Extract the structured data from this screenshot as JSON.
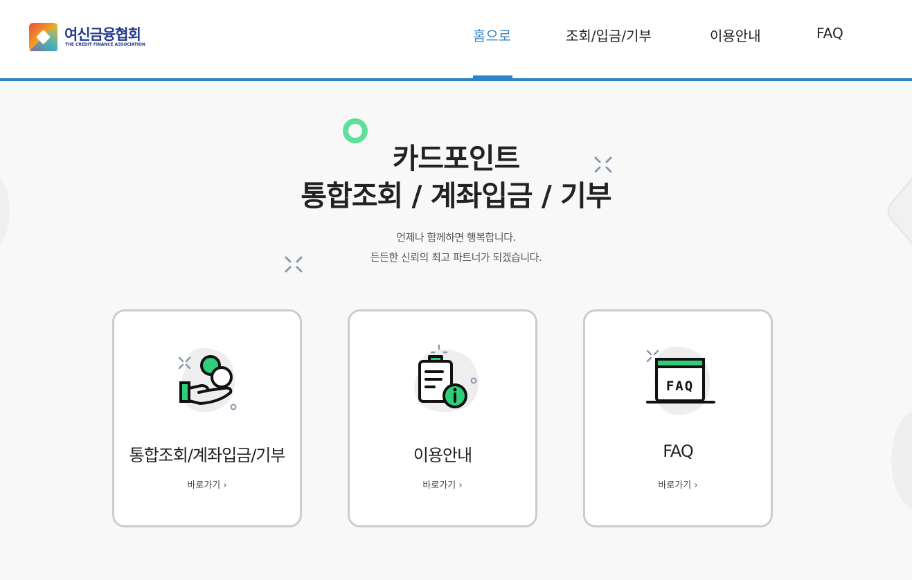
{
  "header": {
    "logo": {
      "name_ko": "여신금융협회",
      "name_en": "THE CREDIT FINANCE ASSOCIATION"
    },
    "nav": [
      {
        "label": "홈으로",
        "active": true
      },
      {
        "label": "조회/입금/기부",
        "active": false
      },
      {
        "label": "이용안내",
        "active": false
      },
      {
        "label": "FAQ",
        "active": false
      }
    ]
  },
  "hero": {
    "title_line1": "카드포인트",
    "title_line2": "통합조회 / 계좌입금 / 기부",
    "subtitle_line1": "언제나 함께하면 행복합니다.",
    "subtitle_line2": "든든한 신뢰의 최고 파트너가 되겠습니다."
  },
  "cards": [
    {
      "title": "통합조회/계좌입금/기부",
      "link": "바로가기",
      "icon": "coin-hand-icon"
    },
    {
      "title": "이용안내",
      "link": "바로가기",
      "icon": "clipboard-info-icon"
    },
    {
      "title": "FAQ",
      "link": "바로가기",
      "icon": "faq-window-icon"
    }
  ],
  "icon_text": {
    "faq": "FAQ"
  },
  "colors": {
    "accent": "#2e86c8",
    "green": "#2fcf7a",
    "card_border": "#cccccc",
    "background": "#f8f8f8"
  }
}
